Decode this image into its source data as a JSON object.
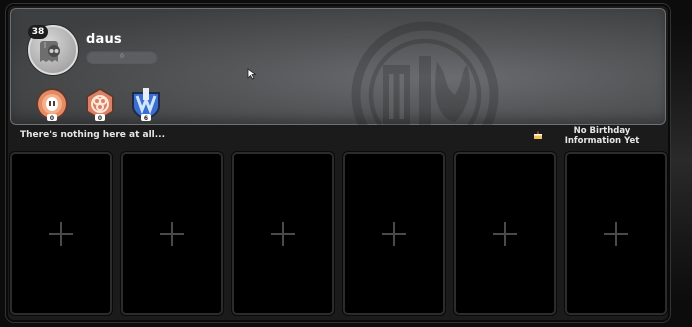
{
  "profile": {
    "level": "38",
    "username": "daus",
    "xp_value": "0"
  },
  "badges": [
    {
      "name": "pig-badge",
      "count": "0",
      "color": "#e58a62"
    },
    {
      "name": "triskelion-badge",
      "count": "0",
      "color": "#d98268"
    },
    {
      "name": "rank-shield-badge",
      "count": "6",
      "color": "#3a6fd0"
    }
  ],
  "info": {
    "motto": "There's nothing here at all...",
    "birthday_line1": "No Birthday",
    "birthday_line2": "Information Yet"
  },
  "slots": [
    {
      "icon": "plus-icon"
    },
    {
      "icon": "plus-icon"
    },
    {
      "icon": "plus-icon"
    },
    {
      "icon": "plus-icon"
    },
    {
      "icon": "plus-icon"
    },
    {
      "icon": "plus-icon"
    }
  ],
  "colors": {
    "banner": "#4a4c4e",
    "slot_bg": "#000000",
    "text": "#e6e6e6"
  }
}
